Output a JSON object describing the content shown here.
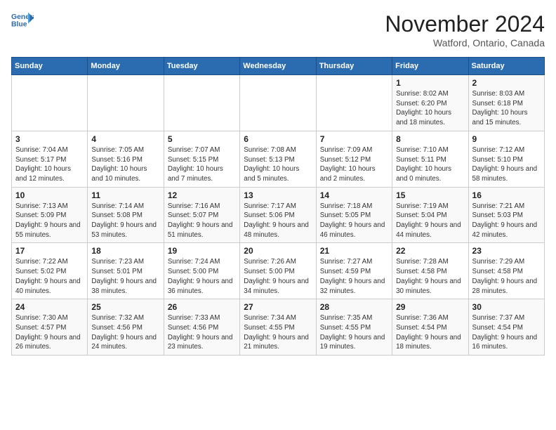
{
  "header": {
    "logo_line1": "General",
    "logo_line2": "Blue",
    "month": "November 2024",
    "location": "Watford, Ontario, Canada"
  },
  "weekdays": [
    "Sunday",
    "Monday",
    "Tuesday",
    "Wednesday",
    "Thursday",
    "Friday",
    "Saturday"
  ],
  "weeks": [
    [
      {
        "day": "",
        "info": ""
      },
      {
        "day": "",
        "info": ""
      },
      {
        "day": "",
        "info": ""
      },
      {
        "day": "",
        "info": ""
      },
      {
        "day": "",
        "info": ""
      },
      {
        "day": "1",
        "info": "Sunrise: 8:02 AM\nSunset: 6:20 PM\nDaylight: 10 hours and 18 minutes."
      },
      {
        "day": "2",
        "info": "Sunrise: 8:03 AM\nSunset: 6:18 PM\nDaylight: 10 hours and 15 minutes."
      }
    ],
    [
      {
        "day": "3",
        "info": "Sunrise: 7:04 AM\nSunset: 5:17 PM\nDaylight: 10 hours and 12 minutes."
      },
      {
        "day": "4",
        "info": "Sunrise: 7:05 AM\nSunset: 5:16 PM\nDaylight: 10 hours and 10 minutes."
      },
      {
        "day": "5",
        "info": "Sunrise: 7:07 AM\nSunset: 5:15 PM\nDaylight: 10 hours and 7 minutes."
      },
      {
        "day": "6",
        "info": "Sunrise: 7:08 AM\nSunset: 5:13 PM\nDaylight: 10 hours and 5 minutes."
      },
      {
        "day": "7",
        "info": "Sunrise: 7:09 AM\nSunset: 5:12 PM\nDaylight: 10 hours and 2 minutes."
      },
      {
        "day": "8",
        "info": "Sunrise: 7:10 AM\nSunset: 5:11 PM\nDaylight: 10 hours and 0 minutes."
      },
      {
        "day": "9",
        "info": "Sunrise: 7:12 AM\nSunset: 5:10 PM\nDaylight: 9 hours and 58 minutes."
      }
    ],
    [
      {
        "day": "10",
        "info": "Sunrise: 7:13 AM\nSunset: 5:09 PM\nDaylight: 9 hours and 55 minutes."
      },
      {
        "day": "11",
        "info": "Sunrise: 7:14 AM\nSunset: 5:08 PM\nDaylight: 9 hours and 53 minutes."
      },
      {
        "day": "12",
        "info": "Sunrise: 7:16 AM\nSunset: 5:07 PM\nDaylight: 9 hours and 51 minutes."
      },
      {
        "day": "13",
        "info": "Sunrise: 7:17 AM\nSunset: 5:06 PM\nDaylight: 9 hours and 48 minutes."
      },
      {
        "day": "14",
        "info": "Sunrise: 7:18 AM\nSunset: 5:05 PM\nDaylight: 9 hours and 46 minutes."
      },
      {
        "day": "15",
        "info": "Sunrise: 7:19 AM\nSunset: 5:04 PM\nDaylight: 9 hours and 44 minutes."
      },
      {
        "day": "16",
        "info": "Sunrise: 7:21 AM\nSunset: 5:03 PM\nDaylight: 9 hours and 42 minutes."
      }
    ],
    [
      {
        "day": "17",
        "info": "Sunrise: 7:22 AM\nSunset: 5:02 PM\nDaylight: 9 hours and 40 minutes."
      },
      {
        "day": "18",
        "info": "Sunrise: 7:23 AM\nSunset: 5:01 PM\nDaylight: 9 hours and 38 minutes."
      },
      {
        "day": "19",
        "info": "Sunrise: 7:24 AM\nSunset: 5:00 PM\nDaylight: 9 hours and 36 minutes."
      },
      {
        "day": "20",
        "info": "Sunrise: 7:26 AM\nSunset: 5:00 PM\nDaylight: 9 hours and 34 minutes."
      },
      {
        "day": "21",
        "info": "Sunrise: 7:27 AM\nSunset: 4:59 PM\nDaylight: 9 hours and 32 minutes."
      },
      {
        "day": "22",
        "info": "Sunrise: 7:28 AM\nSunset: 4:58 PM\nDaylight: 9 hours and 30 minutes."
      },
      {
        "day": "23",
        "info": "Sunrise: 7:29 AM\nSunset: 4:58 PM\nDaylight: 9 hours and 28 minutes."
      }
    ],
    [
      {
        "day": "24",
        "info": "Sunrise: 7:30 AM\nSunset: 4:57 PM\nDaylight: 9 hours and 26 minutes."
      },
      {
        "day": "25",
        "info": "Sunrise: 7:32 AM\nSunset: 4:56 PM\nDaylight: 9 hours and 24 minutes."
      },
      {
        "day": "26",
        "info": "Sunrise: 7:33 AM\nSunset: 4:56 PM\nDaylight: 9 hours and 23 minutes."
      },
      {
        "day": "27",
        "info": "Sunrise: 7:34 AM\nSunset: 4:55 PM\nDaylight: 9 hours and 21 minutes."
      },
      {
        "day": "28",
        "info": "Sunrise: 7:35 AM\nSunset: 4:55 PM\nDaylight: 9 hours and 19 minutes."
      },
      {
        "day": "29",
        "info": "Sunrise: 7:36 AM\nSunset: 4:54 PM\nDaylight: 9 hours and 18 minutes."
      },
      {
        "day": "30",
        "info": "Sunrise: 7:37 AM\nSunset: 4:54 PM\nDaylight: 9 hours and 16 minutes."
      }
    ]
  ]
}
